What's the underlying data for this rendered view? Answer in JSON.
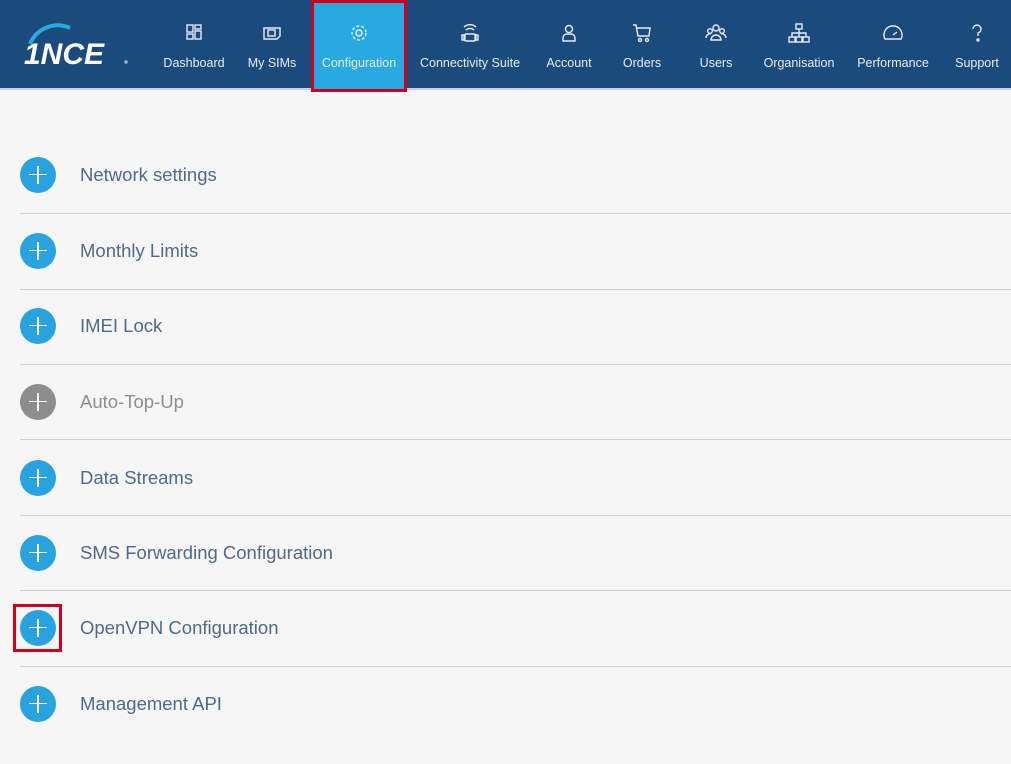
{
  "brand": {
    "logo_text": "1NCE"
  },
  "nav": [
    {
      "label": "Dashboard",
      "icon": "dashboard-icon"
    },
    {
      "label": "My SIMs",
      "icon": "sim-icon"
    },
    {
      "label": "Configuration",
      "icon": "gear-icon",
      "active": true
    },
    {
      "label": "Connectivity Suite",
      "icon": "connectivity-icon"
    },
    {
      "label": "Account",
      "icon": "user-icon"
    },
    {
      "label": "Orders",
      "icon": "cart-icon"
    },
    {
      "label": "Users",
      "icon": "users-icon"
    },
    {
      "label": "Organisation",
      "icon": "org-chart-icon"
    },
    {
      "label": "Performance",
      "icon": "gauge-icon"
    },
    {
      "label": "Support",
      "icon": "question-icon"
    }
  ],
  "sections": [
    {
      "label": "Network settings"
    },
    {
      "label": "Monthly Limits"
    },
    {
      "label": "IMEI Lock"
    },
    {
      "label": "Auto-Top-Up",
      "disabled": true
    },
    {
      "label": "Data Streams"
    },
    {
      "label": "SMS Forwarding Configuration"
    },
    {
      "label": "OpenVPN Configuration"
    },
    {
      "label": "Management API"
    }
  ],
  "colors": {
    "header": "#1b4a7d",
    "accent": "#29a9e1",
    "highlight": "#d0021b"
  }
}
